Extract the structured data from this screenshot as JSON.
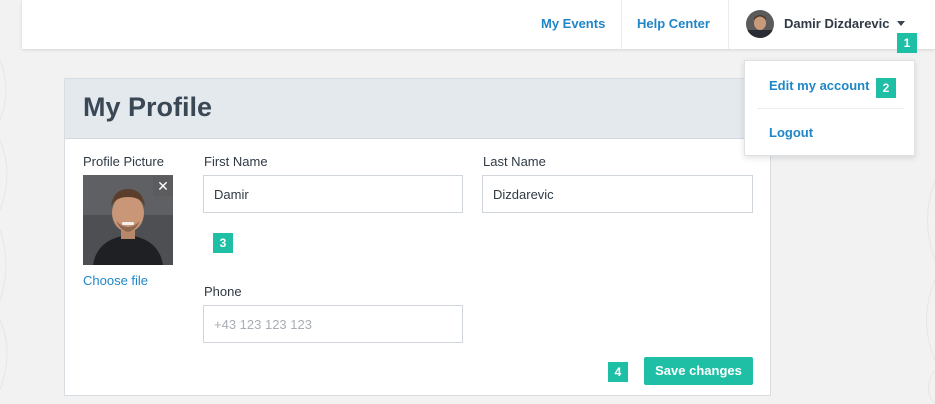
{
  "nav": {
    "my_events": "My Events",
    "help_center": "Help Center",
    "user_name": "Damir Dizdarevic"
  },
  "dropdown": {
    "items": [
      {
        "label": "Edit my account"
      },
      {
        "label": "Logout"
      }
    ]
  },
  "profile": {
    "title": "My Profile",
    "picture_label": "Profile Picture",
    "choose_file": "Choose file",
    "first_name_label": "First Name",
    "first_name_value": "Damir",
    "last_name_label": "Last Name",
    "last_name_value": "Dizdarevic",
    "phone_label": "Phone",
    "phone_placeholder": "+43 123 123 123",
    "save_label": "Save changes"
  },
  "badges": [
    "1",
    "2",
    "3",
    "4"
  ],
  "colors": {
    "accent": "#1fbfa6",
    "link": "#1f86c8",
    "header_bg": "#e4e9ee"
  },
  "icons": [
    "caret-down-icon",
    "close-icon",
    "avatar",
    "profile-photo"
  ]
}
